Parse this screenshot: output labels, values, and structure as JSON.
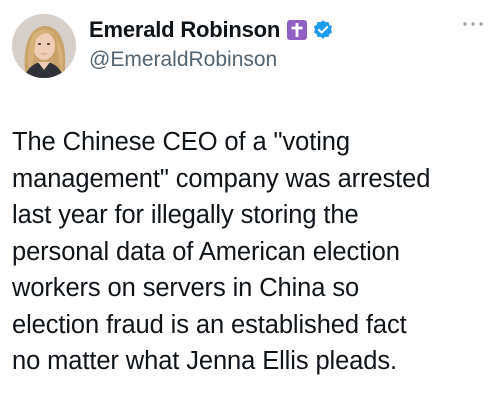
{
  "author": {
    "display_name": "Emerald Robinson",
    "handle": "@EmeraldRobinson",
    "avatar_icon": "profile-photo",
    "badges": [
      "cross-icon",
      "verified-icon"
    ]
  },
  "menu": {
    "more_icon": "more-options-icon"
  },
  "tweet": {
    "text": "The Chinese CEO of a \"voting\nmanagement\" company was arrested\nlast year for illegally storing the\npersonal data of American election\nworkers on servers in China so\nelection fraud is an established fact\nno matter what Jenna Ellis pleads."
  },
  "colors": {
    "text": "#0f1419",
    "secondary": "#536471",
    "verified": "#1d9bf0",
    "cross_badge": "#8f5fc4"
  }
}
